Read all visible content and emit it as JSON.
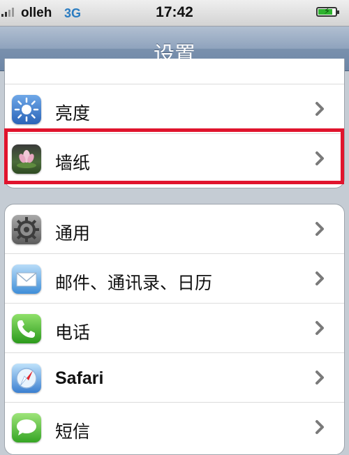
{
  "status_bar": {
    "carrier": "olleh",
    "network": "3G",
    "time": "17:42",
    "battery_level": 0.85
  },
  "nav": {
    "title": "设置"
  },
  "settings": {
    "group1": [
      {
        "label": "亮度",
        "icon": "brightness-icon"
      },
      {
        "label": "墙纸",
        "icon": "wallpaper-icon"
      }
    ],
    "group2": [
      {
        "label": "通用",
        "icon": "general-gear-icon"
      },
      {
        "label": "邮件、通讯录、日历",
        "icon": "mail-icon"
      },
      {
        "label": "电话",
        "icon": "phone-icon"
      },
      {
        "label": "Safari",
        "icon": "safari-compass-icon"
      },
      {
        "label": "短信",
        "icon": "messages-icon"
      }
    ]
  },
  "colors": {
    "highlight": "#e0142d",
    "nav_gradient_top": "#b1bfd1",
    "nav_gradient_bottom": "#6d86a6",
    "page_background": "#c5ccd4"
  }
}
